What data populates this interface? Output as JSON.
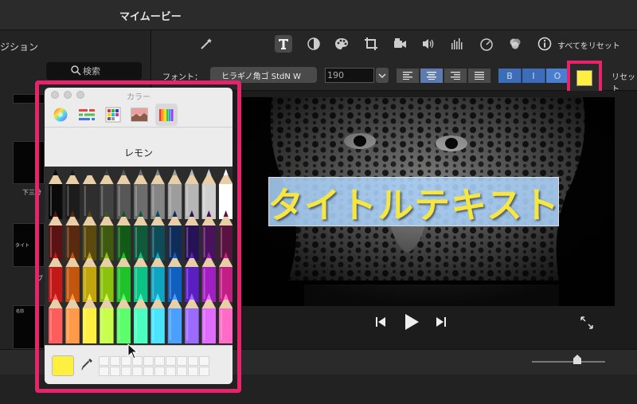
{
  "app": {
    "title": "マイムービー"
  },
  "library": {
    "header": "ジション",
    "search_placeholder": "検索",
    "thumb_labels": [
      "下三分",
      "タイト",
      "ブ",
      "名前"
    ]
  },
  "toolbar": {
    "tools": [
      "magic-wand-icon",
      "title-text-icon",
      "color-balance-icon",
      "color-palette-icon",
      "crop-icon",
      "camera-icon",
      "volume-icon",
      "equalizer-icon",
      "speed-icon",
      "filter-icon"
    ],
    "info_icon": "info-icon",
    "reset_all_label": "すべてをリセット"
  },
  "font_row": {
    "font_label": "フォント：",
    "font_value": "ヒラギノ角ゴ StdN W",
    "size_value": "190",
    "align_options": [
      "left",
      "center",
      "right",
      "justify"
    ],
    "align_selected": "center",
    "style_buttons": [
      "B",
      "I",
      "O"
    ],
    "style_selected": "O",
    "text_color": "#ffef41",
    "reset_label": "リセット"
  },
  "viewer": {
    "title_text": "タイトルテキスト",
    "controls": [
      "skip-back-icon",
      "play-icon",
      "skip-forward-icon",
      "fullscreen-icon"
    ]
  },
  "color_picker": {
    "window_title": "カラー",
    "tabs": [
      "color-wheel-icon",
      "sliders-icon",
      "palettes-icon",
      "image-icon",
      "pencils-icon"
    ],
    "selected_tab": "pencils-icon",
    "selected_color_name": "レモン",
    "selected_color": "#ffef41",
    "pencil_rows": [
      [
        "#0a0a0a",
        "#1c1c1c",
        "#2e2e2e",
        "#424242",
        "#575757",
        "#6d6d6d",
        "#858585",
        "#9d9d9d",
        "#b6b6b6",
        "#cfcfcf",
        "#ffffff"
      ],
      [
        "#5a1212",
        "#5a2a0f",
        "#5a4a0e",
        "#3f5a10",
        "#125a16",
        "#0f5a3c",
        "#0f4c5a",
        "#102c5a",
        "#27125a",
        "#4a125a",
        "#5a1240"
      ],
      [
        "#c21818",
        "#c2560f",
        "#c2a50d",
        "#8cc20e",
        "#1ec22a",
        "#0ec286",
        "#0ea4c2",
        "#1060c2",
        "#5a1ec2",
        "#a11ec2",
        "#c21e84"
      ],
      [
        "#ff5c5c",
        "#ff9a4a",
        "#ffef41",
        "#c7ff4a",
        "#5cff6b",
        "#4affc0",
        "#4ae4ff",
        "#4aa0ff",
        "#9b6bff",
        "#e06bff",
        "#ff6bc5"
      ]
    ],
    "swatch_count": 20
  }
}
